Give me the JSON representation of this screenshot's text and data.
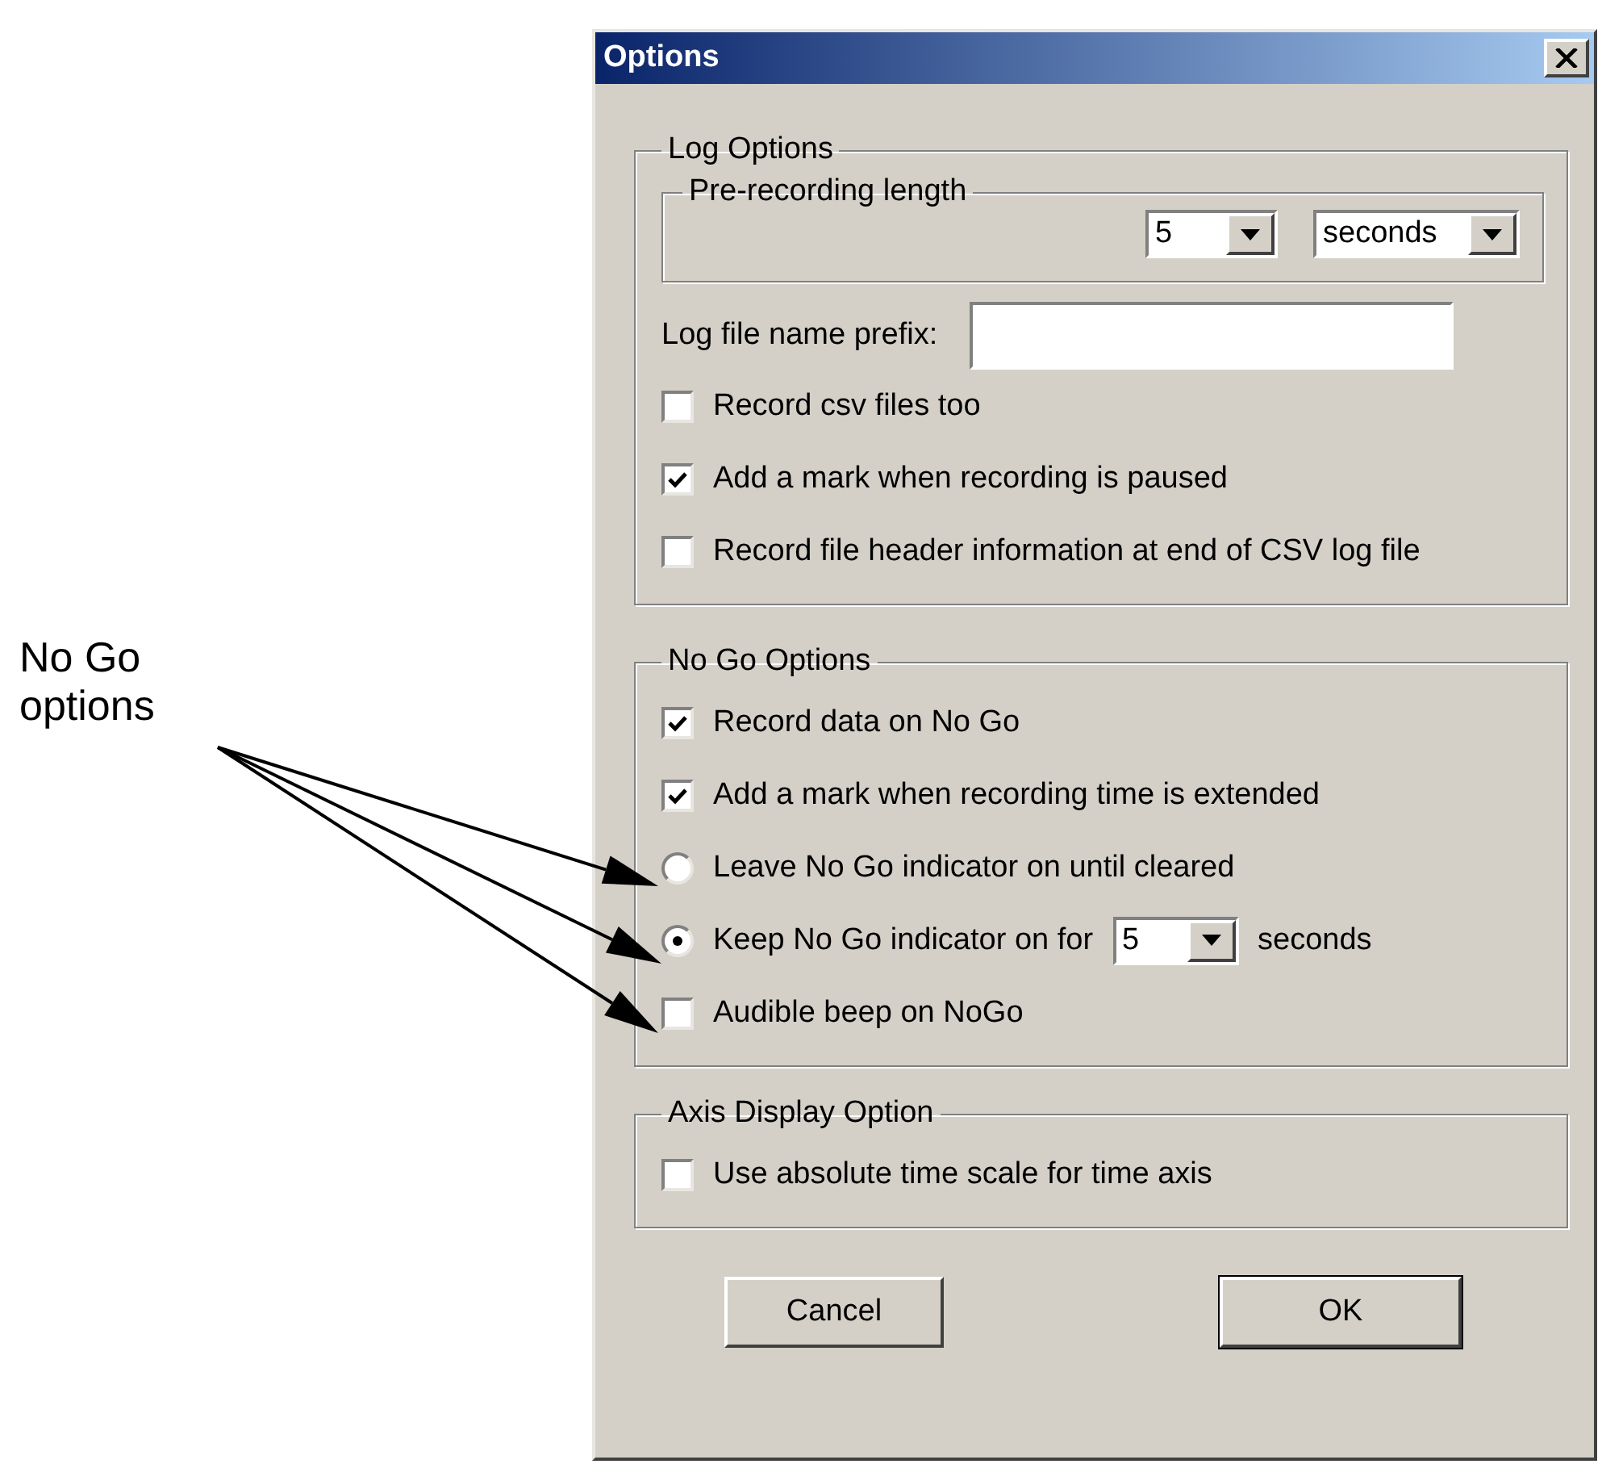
{
  "annotation": {
    "text": "No Go options"
  },
  "window": {
    "title": "Options"
  },
  "log_options": {
    "title": "Log Options",
    "pre_recording": {
      "title": "Pre-recording length",
      "amount": "5",
      "unit": "seconds"
    },
    "prefix_label": "Log file name prefix:",
    "options": [
      {
        "label": "Record csv files too",
        "checked": false
      },
      {
        "label": "Add a mark when recording is paused",
        "checked": true
      },
      {
        "label": "Record file header information at end of CSV log file",
        "checked": false
      }
    ]
  },
  "no_go_options": {
    "title": "No Go Options",
    "items": [
      {
        "kind": "checkbox",
        "label": "Record data on No Go",
        "checked": true
      },
      {
        "kind": "checkbox",
        "label": "Add a mark when recording time is extended",
        "checked": true
      },
      {
        "kind": "radio",
        "label": "Leave No Go indicator on until cleared",
        "selected": false
      },
      {
        "kind": "radio",
        "label": "Keep No Go indicator on for",
        "selected": true,
        "amount": "5",
        "suffix": "seconds"
      },
      {
        "kind": "checkbox",
        "label": "Audible beep on NoGo",
        "checked": false
      }
    ]
  },
  "axis_display": {
    "title": "Axis Display Option",
    "options": [
      {
        "label": "Use absolute time scale for time axis",
        "checked": false
      }
    ]
  },
  "buttons": [
    {
      "label": "Cancel",
      "default": false
    },
    {
      "label": "OK",
      "default": true
    }
  ]
}
